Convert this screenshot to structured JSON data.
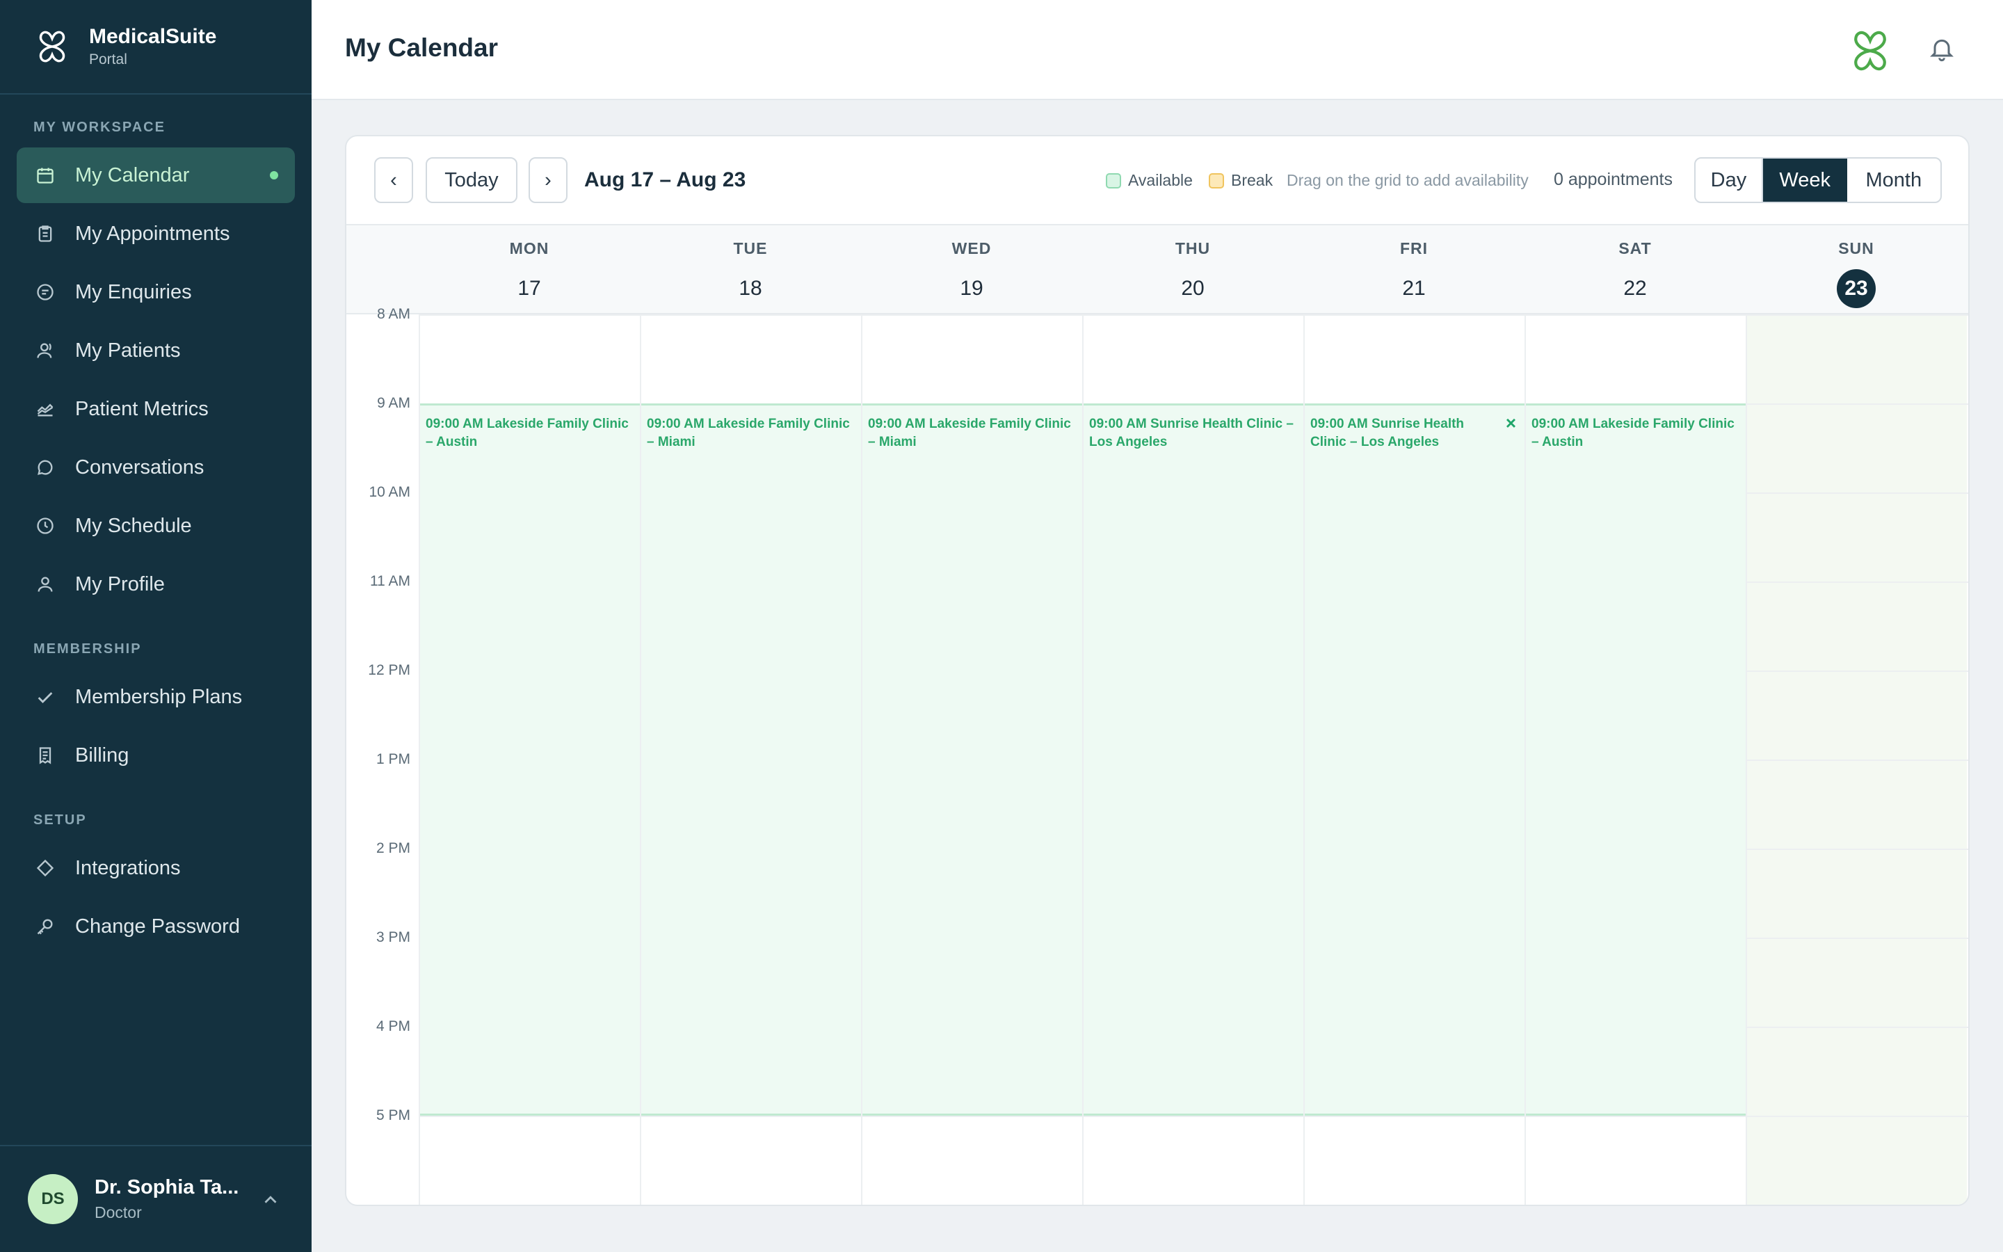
{
  "brand": {
    "name": "MedicalSuite",
    "subtitle": "Portal"
  },
  "sidebar": {
    "sections": [
      {
        "label": "MY WORKSPACE"
      },
      {
        "label": "MEMBERSHIP"
      },
      {
        "label": "SETUP"
      }
    ],
    "items": [
      {
        "label": "My Calendar",
        "icon": "calendar-icon",
        "active": true
      },
      {
        "label": "My Appointments",
        "icon": "clipboard-icon"
      },
      {
        "label": "My Enquiries",
        "icon": "enquiry-icon"
      },
      {
        "label": "My Patients",
        "icon": "patients-icon"
      },
      {
        "label": "Patient Metrics",
        "icon": "metrics-icon"
      },
      {
        "label": "Conversations",
        "icon": "chat-icon"
      },
      {
        "label": "My Schedule",
        "icon": "clock-icon"
      },
      {
        "label": "My Profile",
        "icon": "profile-icon"
      },
      {
        "label": "Membership Plans",
        "icon": "check-icon"
      },
      {
        "label": "Billing",
        "icon": "receipt-icon"
      },
      {
        "label": "Integrations",
        "icon": "diamond-icon"
      },
      {
        "label": "Change Password",
        "icon": "key-icon"
      }
    ]
  },
  "user": {
    "initials": "DS",
    "name": "Dr. Sophia Ta...",
    "role": "Doctor"
  },
  "header": {
    "title": "My Calendar"
  },
  "toolbar": {
    "prev": "‹",
    "today": "Today",
    "next": "›",
    "range": "Aug 17 – Aug 23",
    "legend_available": "Available",
    "legend_break": "Break",
    "hint": "Drag on the grid to add availability",
    "appointments": "0 appointments",
    "views": [
      "Day",
      "Week",
      "Month"
    ],
    "active_view": "Week"
  },
  "colors": {
    "sidebar_bg": "#14313f",
    "available": "#d9f5e5",
    "break": "#fde9b8",
    "accent_green": "#2aa76a"
  },
  "calendar": {
    "days": [
      {
        "name": "MON",
        "num": "17"
      },
      {
        "name": "TUE",
        "num": "18"
      },
      {
        "name": "WED",
        "num": "19"
      },
      {
        "name": "THU",
        "num": "20"
      },
      {
        "name": "FRI",
        "num": "21"
      },
      {
        "name": "SAT",
        "num": "22"
      },
      {
        "name": "SUN",
        "num": "23",
        "today": true
      }
    ],
    "hours": [
      "8 AM",
      "9 AM",
      "10 AM",
      "11 AM",
      "12 PM",
      "1 PM",
      "2 PM",
      "3 PM",
      "4 PM",
      "5 PM"
    ],
    "availability": [
      {
        "day": 0,
        "text": "09:00 AM Lakeside Family Clinic – Austin"
      },
      {
        "day": 1,
        "text": "09:00 AM Lakeside Family Clinic – Miami"
      },
      {
        "day": 2,
        "text": "09:00 AM Lakeside Family Clinic – Miami"
      },
      {
        "day": 3,
        "text": "09:00 AM Sunrise Health Clinic – Los Angeles"
      },
      {
        "day": 4,
        "text": "09:00 AM Sunrise Health Clinic – Los Angeles",
        "remove": "×"
      },
      {
        "day": 5,
        "text": "09:00 AM Lakeside Family Clinic – Austin"
      }
    ]
  }
}
